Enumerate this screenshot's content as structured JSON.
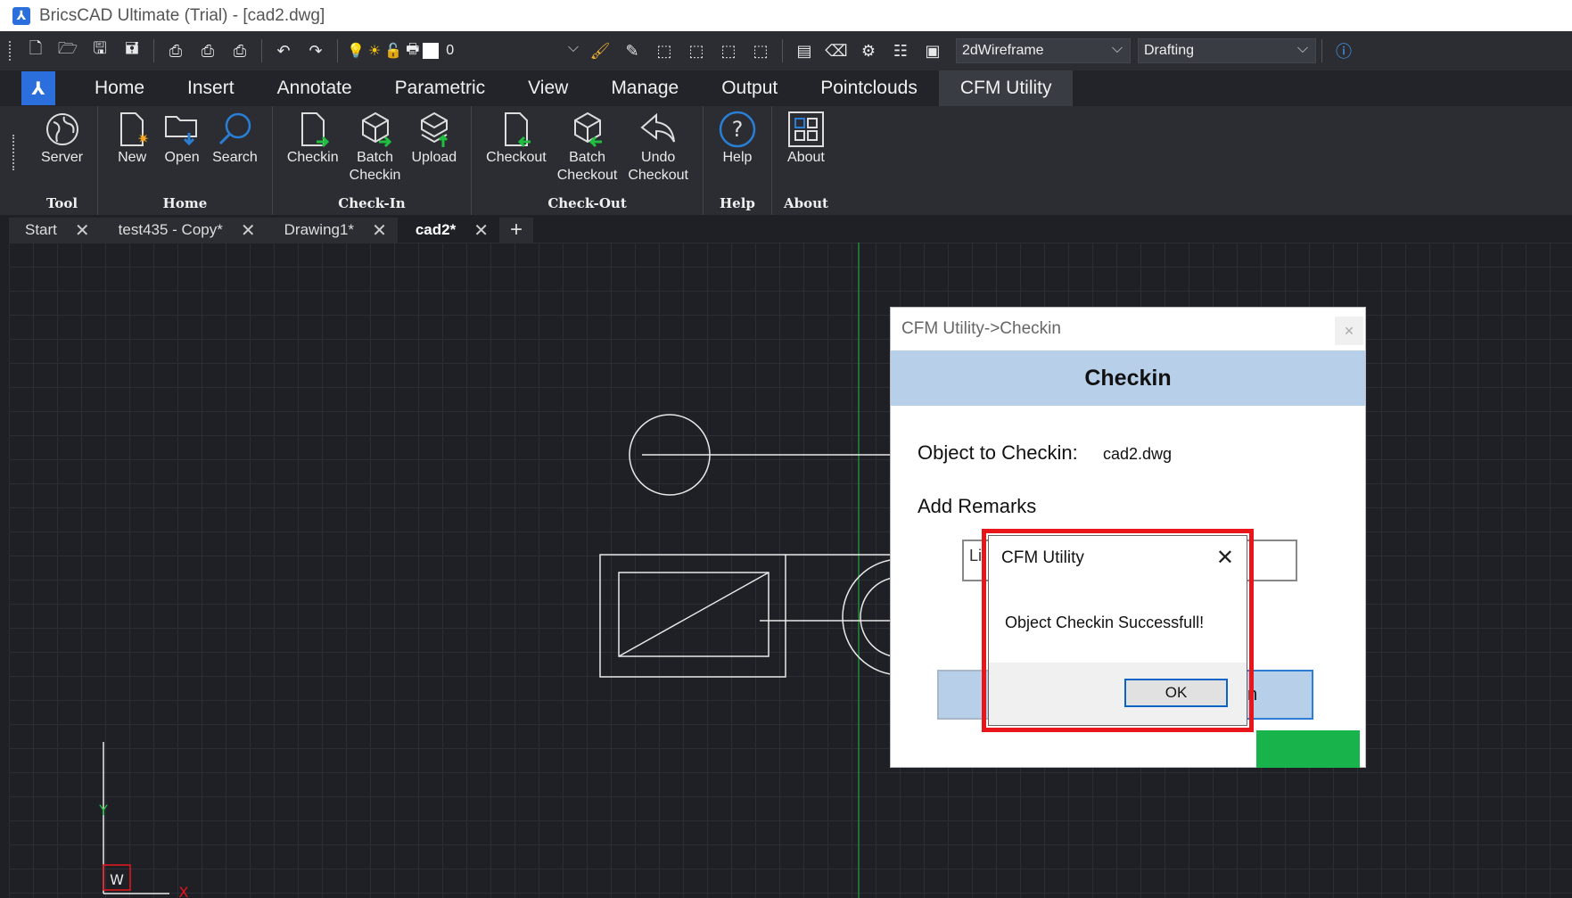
{
  "window": {
    "title": "BricsCAD Ultimate (Trial) - [cad2.dwg]"
  },
  "qat": {
    "layer_value": "0",
    "visual_style": "2dWireframe",
    "workspace": "Drafting"
  },
  "ribbon_tabs": [
    "Home",
    "Insert",
    "Annotate",
    "Parametric",
    "View",
    "Manage",
    "Output",
    "Pointclouds",
    "CFM Utility"
  ],
  "ribbon": {
    "groups": [
      {
        "label": "Tool",
        "buttons": [
          "Server"
        ]
      },
      {
        "label": "Home",
        "buttons": [
          "New",
          "Open",
          "Search"
        ]
      },
      {
        "label": "Check-In",
        "buttons": [
          "Checkin",
          "Batch Checkin",
          "Upload"
        ]
      },
      {
        "label": "Check-Out",
        "buttons": [
          "Checkout",
          "Batch Checkout",
          "Undo Checkout"
        ]
      },
      {
        "label": "Help",
        "buttons": [
          "Help"
        ]
      },
      {
        "label": "About",
        "buttons": [
          "About"
        ]
      }
    ]
  },
  "doc_tabs": [
    "Start",
    "test435 - Copy*",
    "Drawing1*",
    "cad2*"
  ],
  "ucs": {
    "y": "Y",
    "x": "X",
    "w": "W"
  },
  "checkin_dialog": {
    "title": "CFM Utility->Checkin",
    "header": "Checkin",
    "object_label": "Object to Checkin:",
    "object_value": "cad2.dwg",
    "remarks_label": "Add Remarks",
    "remarks_value": "Li",
    "checkin_button_partial": "n"
  },
  "message_box": {
    "title": "CFM Utility",
    "message": "Object Checkin Successfull!",
    "ok": "OK"
  },
  "colors": {
    "accent": "#2a6fdb",
    "highlight": "#e8151b",
    "dialog_header": "#b7cfe9",
    "green": "#18b34a"
  }
}
